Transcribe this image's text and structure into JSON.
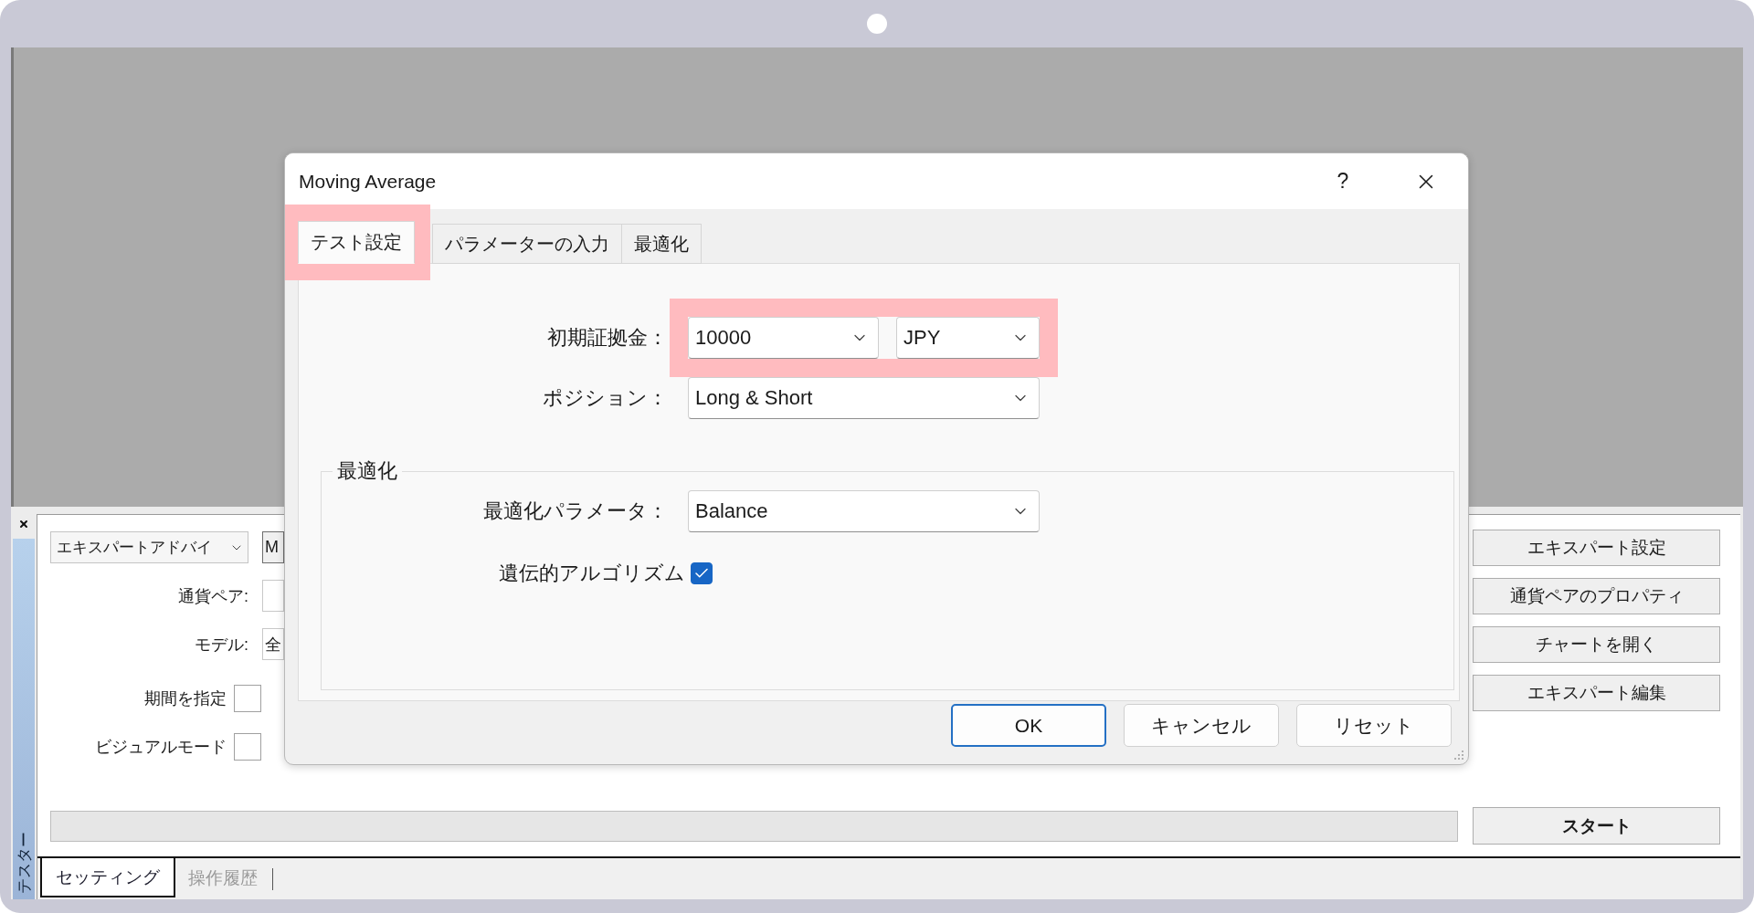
{
  "tester": {
    "side_label": "テスター",
    "expert": {
      "value": "エキスパートアドバイ"
    },
    "expert_field": {
      "value": "M"
    },
    "fields": [
      {
        "label": "通貨ペア:"
      },
      {
        "label": "モデル:",
        "value": "全"
      }
    ],
    "options": [
      {
        "label": "期間を指定",
        "checked": false
      },
      {
        "label": "ビジュアルモード",
        "checked": false
      }
    ],
    "buttons": [
      {
        "label": "エキスパート設定"
      },
      {
        "label": "通貨ペアのプロパティ"
      },
      {
        "label": "チャートを開く"
      },
      {
        "label": "エキスパート編集"
      }
    ],
    "start_button": {
      "label": "スタート"
    },
    "tabs": [
      {
        "label": "セッティング",
        "selected": true
      },
      {
        "label": "操作履歴",
        "selected": false
      }
    ]
  },
  "dialog": {
    "title": "Moving Average",
    "help": "?",
    "tabs": [
      {
        "label": "テスト設定",
        "selected": true,
        "highlighted": true
      },
      {
        "label": "パラメーターの入力",
        "selected": false,
        "highlighted": false
      },
      {
        "label": "最適化",
        "selected": false,
        "highlighted": false
      }
    ],
    "deposit": {
      "label": "初期証拠金：",
      "amount": "10000",
      "currency": "JPY",
      "highlighted": true
    },
    "position": {
      "label": "ポジション：",
      "value": "Long & Short"
    },
    "optimization": {
      "title": "最適化",
      "parameter": {
        "label": "最適化パラメータ：",
        "value": "Balance"
      },
      "genetic": {
        "label": "遺伝的アルゴリズム",
        "checked": true
      }
    },
    "buttons": [
      {
        "label": "OK",
        "default": true
      },
      {
        "label": "キャンセル",
        "default": false
      },
      {
        "label": "リセット",
        "default": false
      }
    ]
  }
}
